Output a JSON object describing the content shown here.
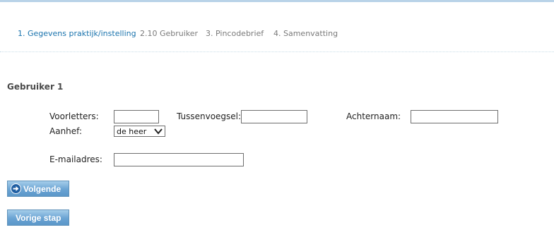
{
  "steps": [
    {
      "label": "1. Gegevens praktijk/instelling",
      "active": true
    },
    {
      "label": "2.10 Gebruiker",
      "active": false
    },
    {
      "label": "3. Pincodebrief",
      "active": false
    },
    {
      "label": "4. Samenvatting",
      "active": false
    }
  ],
  "section_title": "Gebruiker 1",
  "form": {
    "initials_label": "Voorletters:",
    "initials_value": "",
    "infix_label": "Tussenvoegsel:",
    "infix_value": "",
    "surname_label": "Achternaam:",
    "surname_value": "",
    "salutation_label": "Aanhef:",
    "salutation_value": "de heer",
    "email_label": "E-mailadres:",
    "email_value": ""
  },
  "buttons": {
    "next_label": "Volgende",
    "prev_label": "Vorige stap"
  },
  "colors": {
    "active_step": "#1a73ad",
    "inactive_step": "#7a7a7a",
    "button": "#6aa3d3"
  },
  "icons": {
    "next_button_icon": "arrow-right-circle-icon",
    "select_arrow": "chevron-down-icon"
  }
}
